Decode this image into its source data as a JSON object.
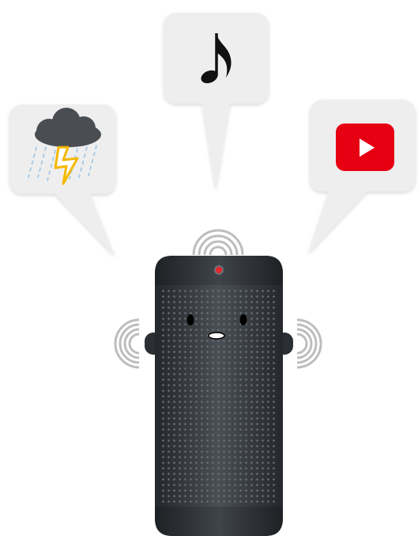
{
  "bubbles": [
    {
      "id": "weather",
      "icon": "thunderstorm-icon"
    },
    {
      "id": "music",
      "icon": "music-note-icon"
    },
    {
      "id": "video",
      "icon": "play-button-icon"
    }
  ],
  "speaker": {
    "body_color": "#3b3f44",
    "led_color": "#e3262a",
    "face": "smiling-face"
  },
  "colors": {
    "bubble_fill": "#eeeeee",
    "play_red": "#e60012",
    "bolt": "#f5b800",
    "rain": "#9ec6e6"
  }
}
